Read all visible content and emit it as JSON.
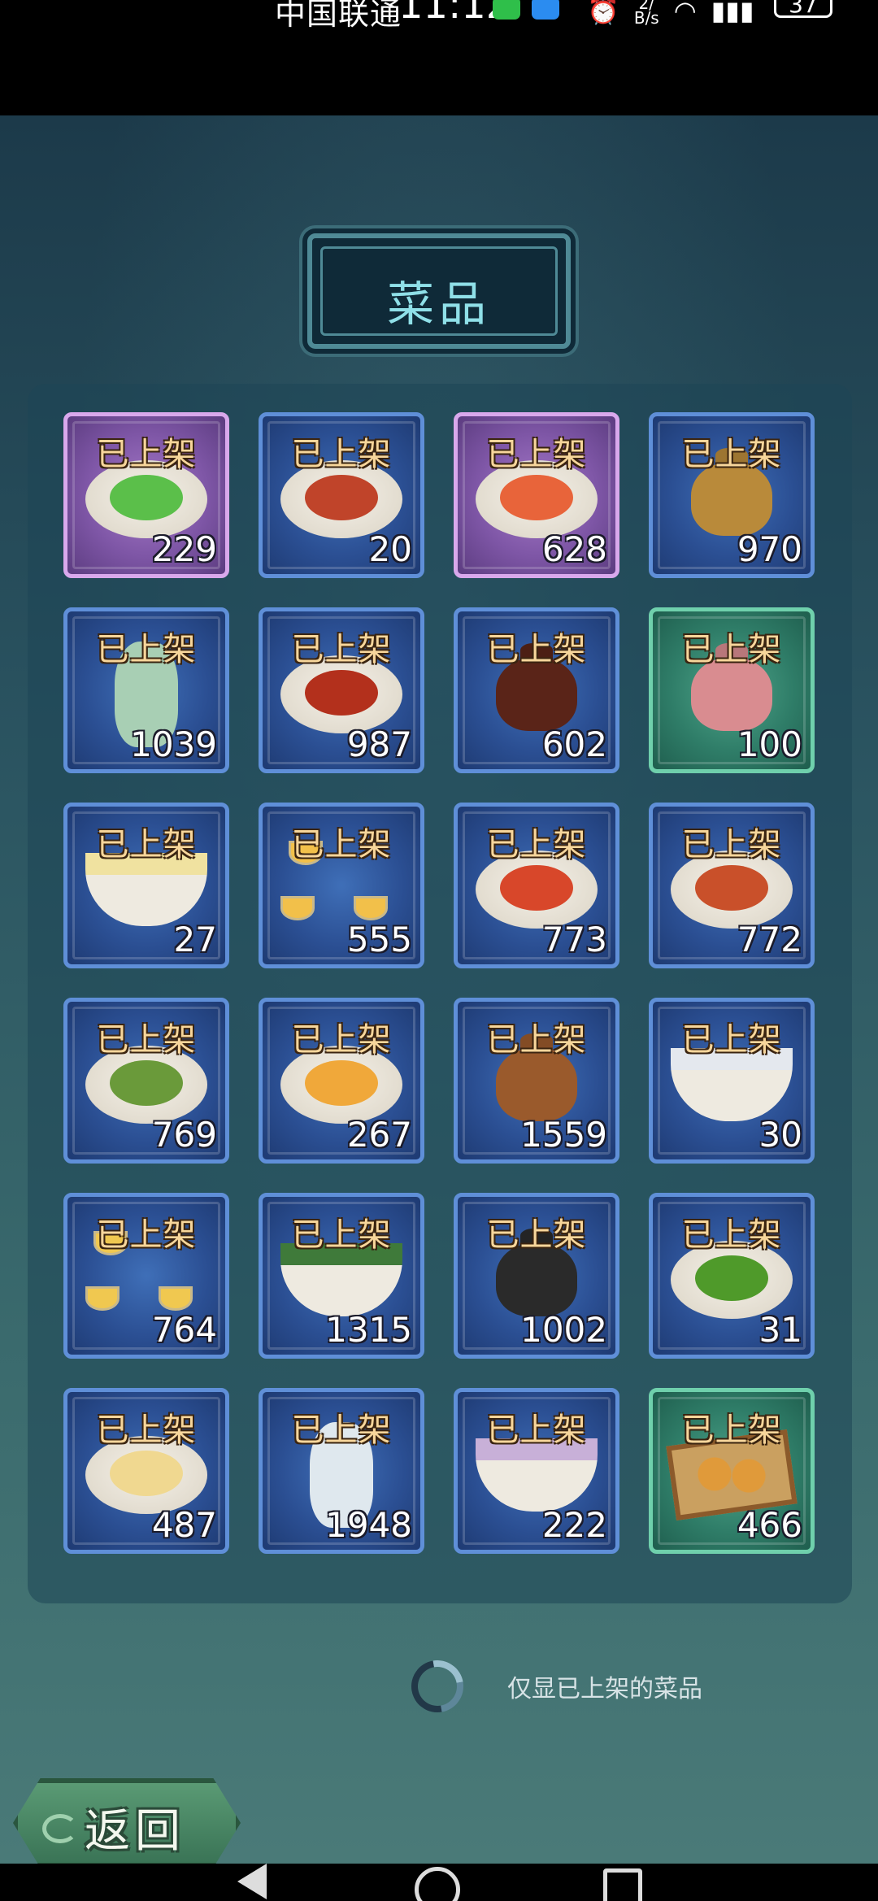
{
  "status_bar": {
    "carrier": "中国联通",
    "time": "11:12",
    "net_speed_value": "2/",
    "net_speed_unit": "B/s",
    "battery": "37"
  },
  "page": {
    "title": "菜品"
  },
  "dishes": [
    {
      "status": "已上架",
      "count": "229",
      "rarity": "purple",
      "art": "cucumber-plate-icon"
    },
    {
      "status": "已上架",
      "count": "20",
      "rarity": "blue",
      "art": "stir-fry-plate-icon"
    },
    {
      "status": "已上架",
      "count": "628",
      "rarity": "purple",
      "art": "shrimp-plate-icon"
    },
    {
      "status": "已上架",
      "count": "970",
      "rarity": "blue",
      "art": "golden-teapot-icon"
    },
    {
      "status": "已上架",
      "count": "1039",
      "rarity": "blue",
      "art": "celadon-ewer-icon"
    },
    {
      "status": "已上架",
      "count": "987",
      "rarity": "blue",
      "art": "braised-meat-plate-icon"
    },
    {
      "status": "已上架",
      "count": "602",
      "rarity": "blue",
      "art": "wine-jar-icon"
    },
    {
      "status": "已上架",
      "count": "100",
      "rarity": "green",
      "art": "pink-teapot-icon"
    },
    {
      "status": "已上架",
      "count": "27",
      "rarity": "blue",
      "art": "mashed-potato-bowl-icon"
    },
    {
      "status": "已上架",
      "count": "555",
      "rarity": "blue",
      "art": "tea-cups-icon"
    },
    {
      "status": "已上架",
      "count": "773",
      "rarity": "blue",
      "art": "skewer-tray-icon"
    },
    {
      "status": "已上架",
      "count": "772",
      "rarity": "blue",
      "art": "shredded-stir-fry-icon"
    },
    {
      "status": "已上架",
      "count": "769",
      "rarity": "blue",
      "art": "okra-plate-icon"
    },
    {
      "status": "已上架",
      "count": "267",
      "rarity": "blue",
      "art": "chrysanthemum-plate-icon"
    },
    {
      "status": "已上架",
      "count": "1559",
      "rarity": "blue",
      "art": "copper-kettle-icon"
    },
    {
      "status": "已上架",
      "count": "30",
      "rarity": "blue",
      "art": "rice-ball-bowl-icon"
    },
    {
      "status": "已上架",
      "count": "764",
      "rarity": "blue",
      "art": "porcelain-tea-set-icon"
    },
    {
      "status": "已上架",
      "count": "1315",
      "rarity": "blue",
      "art": "green-tea-bowl-icon"
    },
    {
      "status": "已上架",
      "count": "1002",
      "rarity": "blue",
      "art": "black-teapot-icon"
    },
    {
      "status": "已上架",
      "count": "31",
      "rarity": "blue",
      "art": "peas-plate-icon"
    },
    {
      "status": "已上架",
      "count": "487",
      "rarity": "blue",
      "art": "tofu-plate-icon"
    },
    {
      "status": "已上架",
      "count": "1948",
      "rarity": "blue",
      "art": "white-wine-ewer-icon"
    },
    {
      "status": "已上架",
      "count": "222",
      "rarity": "blue",
      "art": "taro-dumpling-bowl-icon"
    },
    {
      "status": "已上架",
      "count": "466",
      "rarity": "green",
      "art": "pastry-tray-icon"
    }
  ],
  "filter": {
    "label": "仅显已上架的菜品"
  },
  "back_button": {
    "label": "返回"
  },
  "colors": {
    "rarity_blue": "#2b4f93",
    "rarity_purple": "#7e56a6",
    "rarity_green": "#2f7d68",
    "label_gold": "#f7d69b",
    "title_cyan": "#8fe0e8"
  }
}
